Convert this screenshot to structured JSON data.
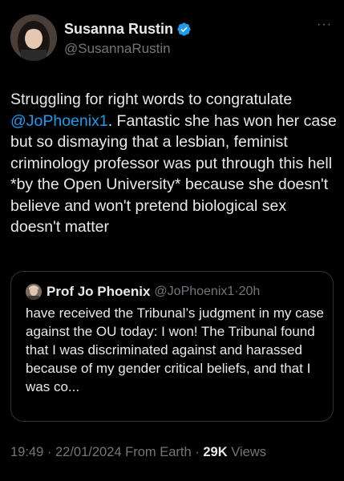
{
  "author": {
    "display_name": "Susanna Rustin",
    "handle": "@SusannaRustin",
    "verified_icon": "verified-badge-icon",
    "more_label": "···"
  },
  "tweet": {
    "text_before": "Struggling for right words to congratulate ",
    "mention": "@JoPhoenix1",
    "text_after": ". Fantastic she has won her case but so dismaying that a lesbian, feminist criminology professor was put through this hell *by the Open University* because she doesn't believe and won't pretend biological sex doesn't matter"
  },
  "quoted": {
    "display_name": "Prof Jo Phoenix",
    "handle": "@JoPhoenix1",
    "separator": "·",
    "time": "20h",
    "text": "have received the Tribunal’s judgment in my case against the OU today: I won! The Tribunal found that I was discriminated against and harassed because of my gender critical beliefs, and that I was co..."
  },
  "meta": {
    "time": "19:49",
    "separator": " · ",
    "date": "22/01/2024",
    "source": "From Earth",
    "views_count": "29K",
    "views_label": "Views"
  },
  "colors": {
    "background": "#000000",
    "text": "#e7e9ea",
    "secondary": "#71767b",
    "link": "#1d9bf0",
    "border": "#2f3336"
  }
}
